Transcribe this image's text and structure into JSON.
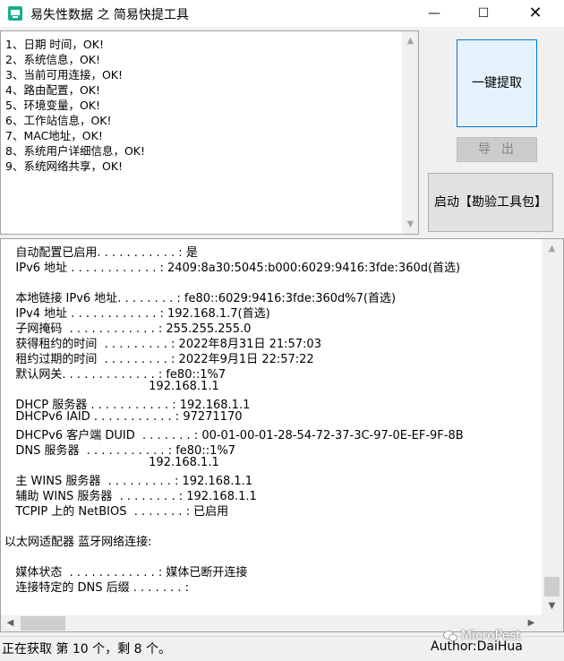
{
  "window": {
    "title": "易失性数据 之 简易快提工具"
  },
  "status_lines": [
    "1、日期 时间，OK!",
    "2、系统信息，OK!",
    "3、当前可用连接，OK!",
    "4、路由配置，OK!",
    "5、环境变量，OK!",
    "6、工作站信息，OK!",
    "7、MAC地址，OK!",
    "8、系统用户详细信息，OK!",
    "9、系统网络共享，OK!"
  ],
  "buttons": {
    "extract": "一键提取",
    "export": "导出",
    "toolkit": "启动【勘验工具包】"
  },
  "output_lines": [
    "   自动配置已启用. . . . . . . . . . . : 是",
    "   IPv6 地址 . . . . . . . . . . . . : 2409:8a30:5045:b000:6029:9416:3fde:360d(首选)",
    "",
    "   本地链接 IPv6 地址. . . . . . . . : fe80::6029:9416:3fde:360d%7(首选)",
    "   IPv4 地址 . . . . . . . . . . . . : 192.168.1.7(首选)",
    "   子网掩码  . . . . . . . . . . . . : 255.255.255.0",
    "   获得租约的时间  . . . . . . . . . : 2022年8月31日 21:57:03",
    "   租约过期的时间  . . . . . . . . . : 2022年9月1日 22:57:22",
    "   默认网关. . . . . . . . . . . . . : fe80::1%7",
    "                                       192.168.1.1",
    "   DHCP 服务器 . . . . . . . . . . . : 192.168.1.1",
    "   DHCPv6 IAID . . . . . . . . . . . : 97271170",
    "   DHCPv6 客户端 DUID  . . . . . . . : 00-01-00-01-28-54-72-37-3C-97-0E-EF-9F-8B",
    "   DNS 服务器  . . . . . . . . . . . : fe80::1%7",
    "                                       192.168.1.1",
    "   主 WINS 服务器  . . . . . . . . . : 192.168.1.1",
    "   辅助 WINS 服务器  . . . . . . . . : 192.168.1.1",
    "   TCPIP 上的 NetBIOS  . . . . . . . : 已启用",
    "",
    "以太网适配器 蓝牙网络连接:",
    "",
    "   媒体状态  . . . . . . . . . . . . : 媒体已断开连接",
    "   连接特定的 DNS 后缀 . . . . . . . :"
  ],
  "statusbar": {
    "progress_text": "正在获取 第 10 个，剩 8 个。",
    "author": "Author:DaiHua"
  },
  "watermark": "MicroPest",
  "colors": {
    "accent": "#0078d7",
    "icon": "#1aad8c"
  }
}
